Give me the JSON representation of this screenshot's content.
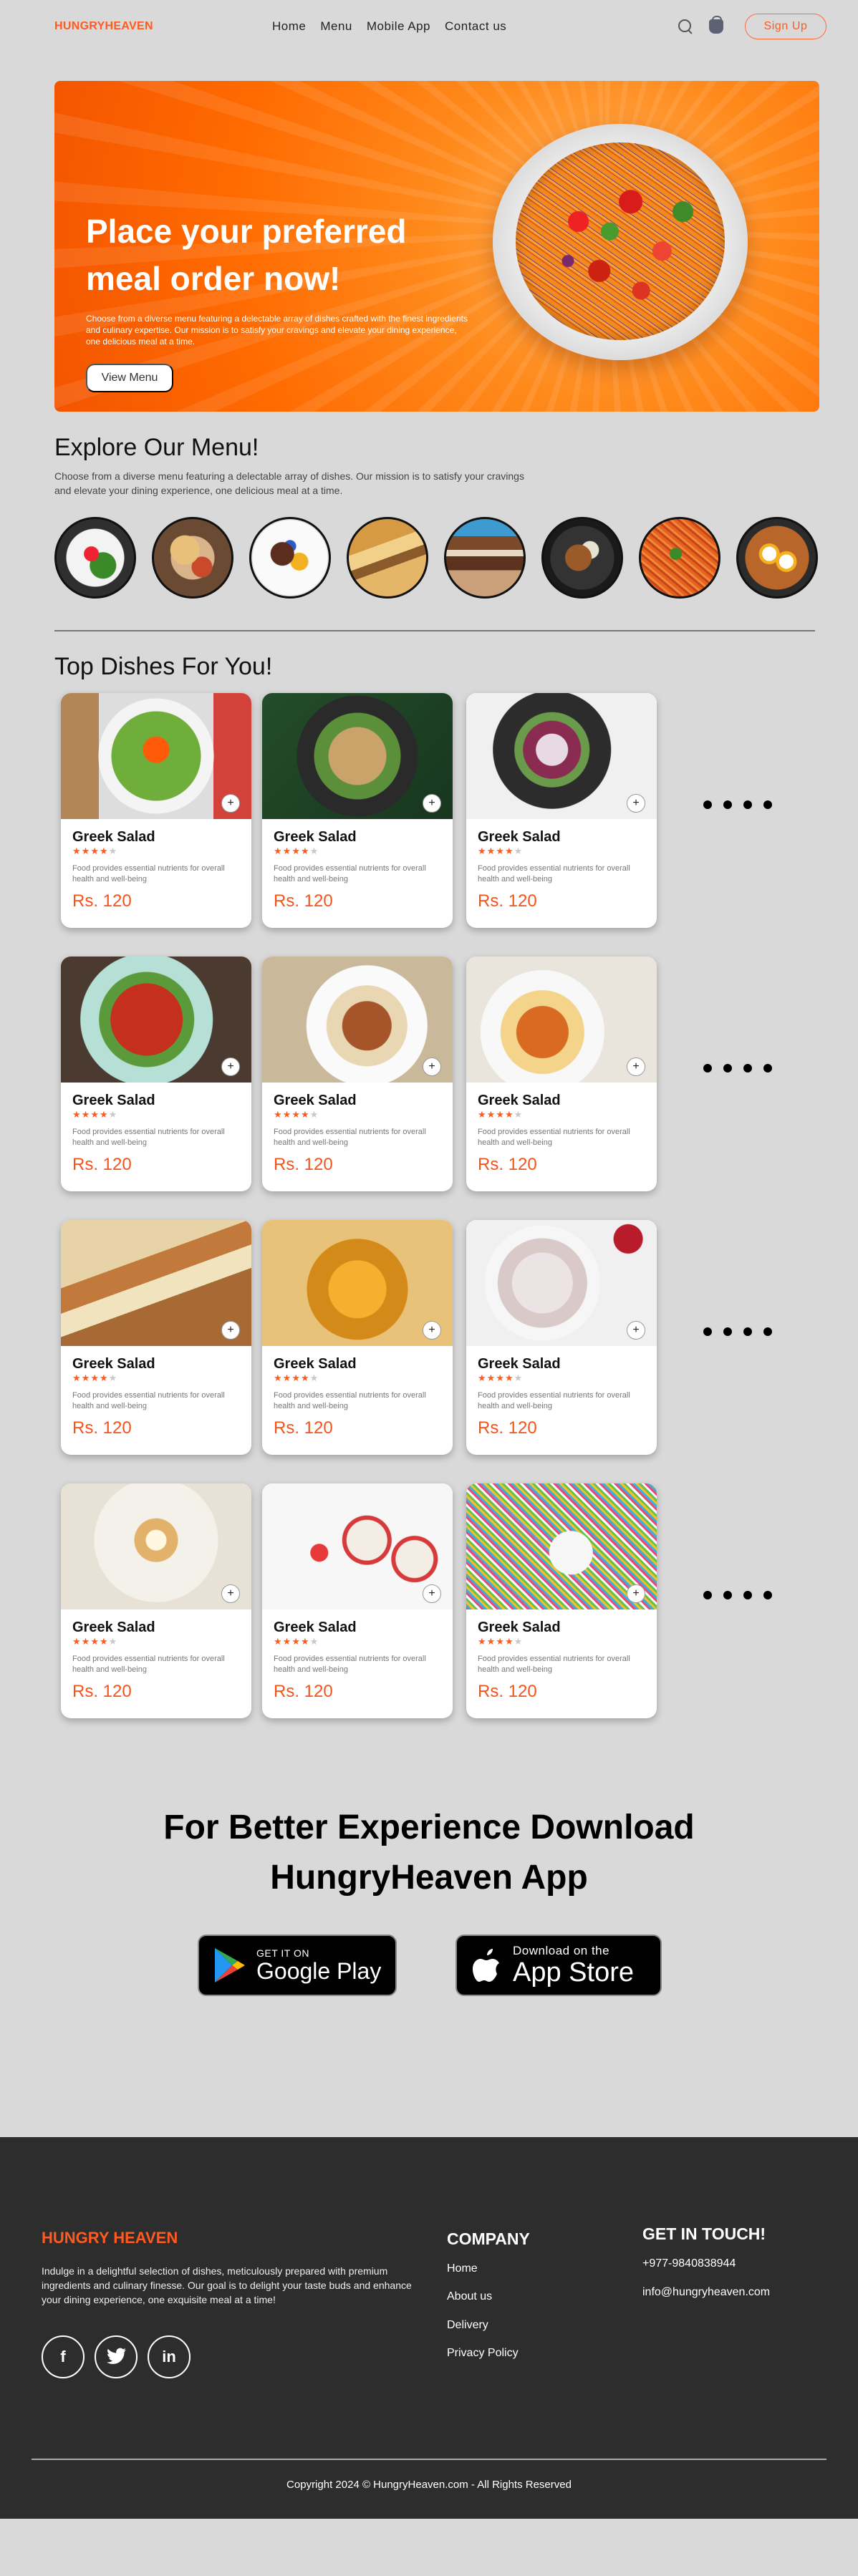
{
  "nav": {
    "brand": "HUNGRYHEAVEN",
    "links": [
      "Home",
      "Menu",
      "Mobile App",
      "Contact us"
    ],
    "signup_label": "Sign Up"
  },
  "hero": {
    "title_line1": "Place your preferred",
    "title_line2": "meal order now!",
    "description": "Choose from a diverse menu featuring a delectable array of dishes crafted with the finest ingredients and culinary expertise. Our mission is to satisfy your cravings and elevate your dining experience, one delicious meal at a time.",
    "button_label": "View Menu"
  },
  "explore": {
    "title": "Explore Our Menu!",
    "description": "Choose from a diverse menu featuring a delectable array of dishes. Our mission is to satisfy your cravings and elevate your dining experience, one delicious meal at a time."
  },
  "dishes": {
    "title": "Top Dishes For You!",
    "items": [
      {
        "name": "Greek Salad",
        "rating": 4,
        "description": "Food provides essential nutrients for overall health and well-being",
        "price": "Rs. 120"
      },
      {
        "name": "Greek Salad",
        "rating": 4,
        "description": "Food provides essential nutrients for overall health and well-being",
        "price": "Rs. 120"
      },
      {
        "name": "Greek Salad",
        "rating": 4,
        "description": "Food provides essential nutrients for overall health and well-being",
        "price": "Rs. 120"
      },
      {
        "name": "Greek Salad",
        "rating": 4,
        "description": "Food provides essential nutrients for overall health and well-being",
        "price": "Rs. 120"
      },
      {
        "name": "Greek Salad",
        "rating": 4,
        "description": "Food provides essential nutrients for overall health and well-being",
        "price": "Rs. 120"
      },
      {
        "name": "Greek Salad",
        "rating": 4,
        "description": "Food provides essential nutrients for overall health and well-being",
        "price": "Rs. 120"
      },
      {
        "name": "Greek Salad",
        "rating": 4,
        "description": "Food provides essential nutrients for overall health and well-being",
        "price": "Rs. 120"
      },
      {
        "name": "Greek Salad",
        "rating": 4,
        "description": "Food provides essential nutrients for overall health and well-being",
        "price": "Rs. 120"
      },
      {
        "name": "Greek Salad",
        "rating": 4,
        "description": "Food provides essential nutrients for overall health and well-being",
        "price": "Rs. 120"
      },
      {
        "name": "Greek Salad",
        "rating": 4,
        "description": "Food provides essential nutrients for overall health and well-being",
        "price": "Rs. 120"
      },
      {
        "name": "Greek Salad",
        "rating": 4,
        "description": "Food provides essential nutrients for overall health and well-being",
        "price": "Rs. 120"
      },
      {
        "name": "Greek Salad",
        "rating": 4,
        "description": "Food provides essential nutrients for overall health and well-being",
        "price": "Rs. 120"
      }
    ]
  },
  "download": {
    "title_line1": "For Better Experience Download",
    "title_line2": "HungryHeaven App",
    "google_small": "GET IT ON",
    "google_big": "Google Play",
    "apple_small": "Download on the",
    "apple_big": "App Store"
  },
  "footer": {
    "brand": "HUNGRY HEAVEN",
    "description": "Indulge in a delightful selection of dishes, meticulously prepared with premium ingredients and culinary finesse. Our goal is to delight your taste buds and enhance your dining experience, one exquisite meal at a time!",
    "company_title": "COMPANY",
    "company_links": [
      "Home",
      "About us",
      "Delivery",
      "Privacy Policy"
    ],
    "contact_title": "GET IN TOUCH!",
    "phone": "+977-9840838944",
    "email": "info@hungryheaven.com",
    "copyright": "Copyright 2024 © HungryHeaven.com - All Rights Reserved"
  },
  "colors": {
    "accent": "#ff5a1f",
    "hero_orange": "#ff6a00",
    "footer_bg": "#2d2d2d",
    "page_bg": "#d9d9d9"
  },
  "icons": [
    "search-icon",
    "cart-icon",
    "add-icon",
    "star-icon",
    "google-play-icon",
    "apple-icon",
    "facebook-icon",
    "twitter-icon",
    "linkedin-icon"
  ]
}
